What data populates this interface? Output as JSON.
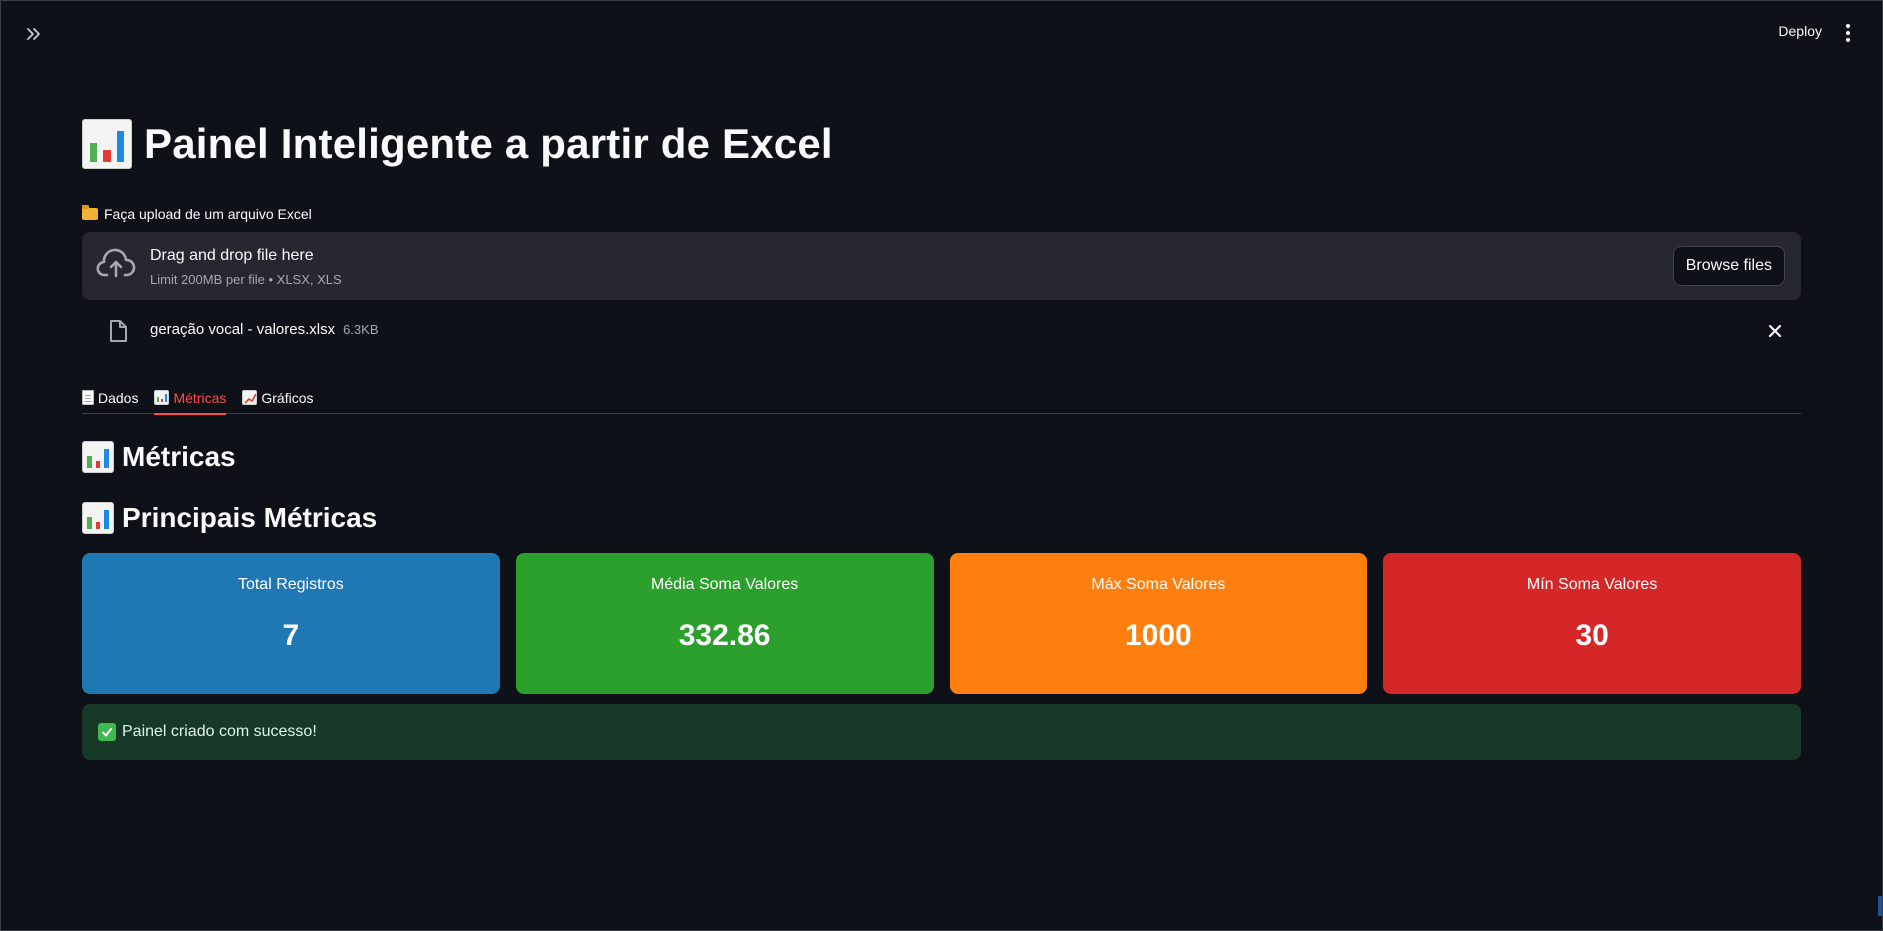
{
  "header": {
    "deploy_label": "Deploy",
    "sidebar_toggle_icon": "double-chevron-right-icon",
    "menu_icon": "vertical-dots-icon"
  },
  "page": {
    "title_icon": "bar-chart-emoji",
    "title": "Painel Inteligente a partir de Excel"
  },
  "uploader": {
    "label_icon": "open-folder-emoji",
    "label": "Faça upload de um arquivo Excel",
    "drop_title": "Drag and drop file here",
    "drop_subtitle": "Limit 200MB per file • XLSX, XLS",
    "browse_label": "Browse files",
    "file": {
      "name": "geração vocal - valores.xlsx",
      "size": "6.3KB"
    }
  },
  "tabs": [
    {
      "icon": "page-emoji",
      "label": "Dados",
      "active": false
    },
    {
      "icon": "bar-chart-emoji",
      "label": "Métricas",
      "active": true
    },
    {
      "icon": "chart-increasing-emoji",
      "label": "Gráficos",
      "active": false
    }
  ],
  "section": {
    "heading": "Métricas",
    "subheading": "Principais Métricas"
  },
  "metrics": [
    {
      "label": "Total Registros",
      "value": "7",
      "color": "#1f77b4"
    },
    {
      "label": "Média Soma Valores",
      "value": "332.86",
      "color": "#2ca02c"
    },
    {
      "label": "Máx Soma Valores",
      "value": "1000",
      "color": "#ff7f0e"
    },
    {
      "label": "Mín Soma Valores",
      "value": "30",
      "color": "#d62728"
    }
  ],
  "success": {
    "icon": "check-mark-emoji",
    "text": "Painel criado com sucesso!"
  },
  "colors": {
    "background": "#0e1117",
    "accent": "#ff4b4b",
    "panel": "#262730",
    "success_bg": "#173928"
  }
}
